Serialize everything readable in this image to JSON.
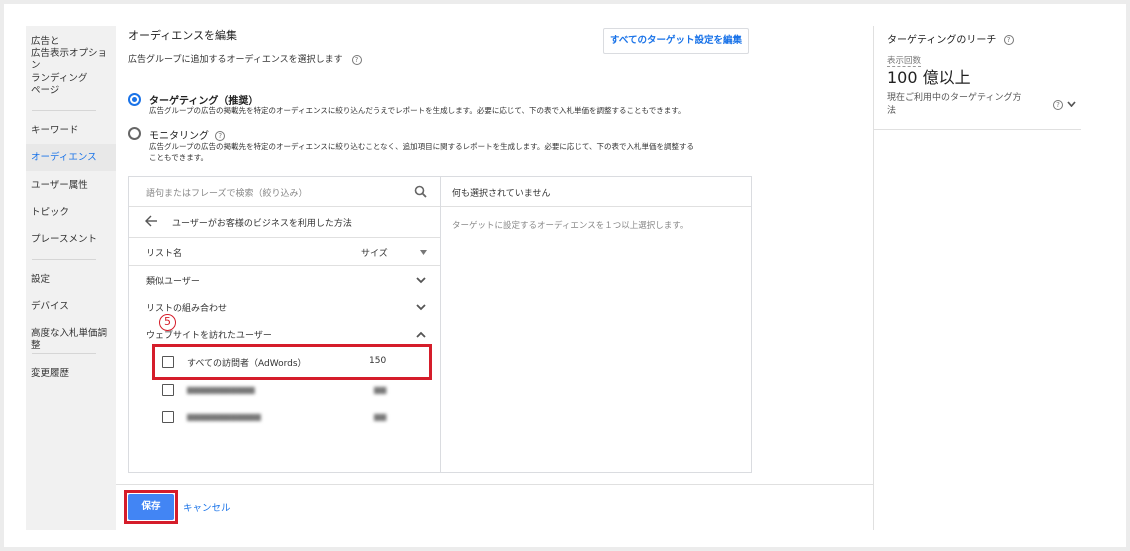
{
  "sidebar": {
    "items": [
      {
        "line1": "広告と",
        "line2": "広告表示オプション"
      },
      {
        "line1": "ランディング",
        "line2": "ページ"
      },
      {
        "label": "キーワード"
      },
      {
        "label": "オーディエンス"
      },
      {
        "label": "ユーザー属性"
      },
      {
        "label": "トピック"
      },
      {
        "label": "プレースメント"
      },
      {
        "label": "設定"
      },
      {
        "label": "デバイス"
      },
      {
        "label": "高度な入札単価調整"
      },
      {
        "label": "変更履歴"
      }
    ]
  },
  "header": {
    "title": "オーディエンスを編集",
    "subtitle": "広告グループに追加するオーディエンスを選択します",
    "edit_all_button": "すべてのターゲット設定を編集",
    "help_icon": "?"
  },
  "options": {
    "targeting": {
      "label": "ターゲティング（推奨）",
      "desc": "広告グループの広告の掲載先を特定のオーディエンスに絞り込んだうえでレポートを生成します。必要に応じて、下の表で入札単価を調整することもできます。"
    },
    "monitoring": {
      "label": "モニタリング",
      "desc1": "広告グループの広告の掲載先を特定のオーディエンスに絞り込むことなく、追加項目に関するレポートを生成します。必要に応じて、下の表で入札単価を調整する",
      "desc2": "こともできます。"
    }
  },
  "panel": {
    "search_placeholder": "語句またはフレーズで検索（絞り込み）",
    "back_label": "ユーザーがお客様のビジネスを利用した方法",
    "col_list_name": "リスト名",
    "col_size": "サイズ",
    "groups": [
      {
        "label": "類似ユーザー"
      },
      {
        "label": "リストの組み合わせ"
      },
      {
        "label": "ウェブサイトを訪れたユーザー"
      }
    ],
    "item_all_visitors": {
      "label": "すべての訪問者（AdWords）",
      "size": "150"
    },
    "right_header": "何も選択されていません",
    "right_hint": "ターゲットに設定するオーディエンスを１つ以上選択します。"
  },
  "annotation": {
    "step": "5"
  },
  "footer": {
    "save": "保存",
    "cancel": "キャンセル"
  },
  "reach": {
    "title": "ターゲティングのリーチ",
    "impressions_label": "表示回数",
    "impressions_value": "100 億以上",
    "note_line1": "現在ご利用中のターゲティング方",
    "note_line2": "法"
  },
  "colors": {
    "accent": "#1a73e8",
    "highlight": "#d51d2a",
    "save_bg": "#4285f4"
  }
}
